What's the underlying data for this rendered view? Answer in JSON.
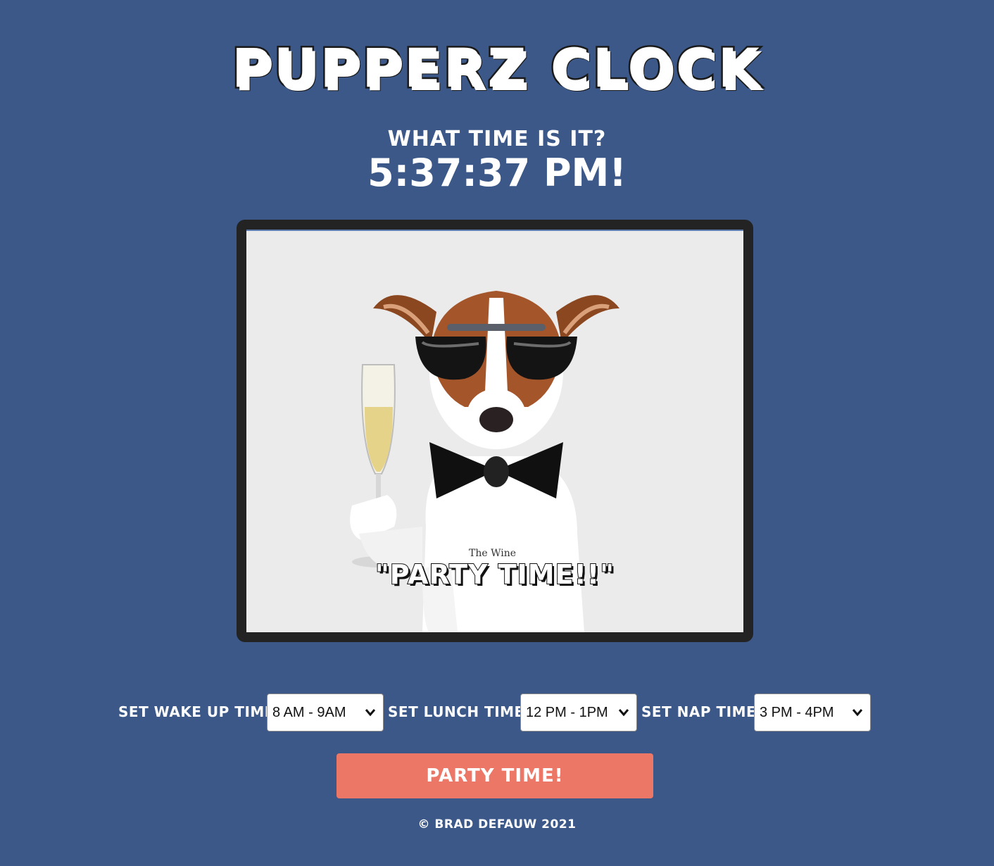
{
  "header": {
    "title": "PUPPERZ CLOCK",
    "question": "WHAT TIME IS IT?",
    "time": "5:37:37 PM!"
  },
  "image": {
    "caption": "\"PARTY TIME!!\"",
    "watermark": "The Wine"
  },
  "controls": {
    "wake": {
      "label": "SET WAKE UP TIME",
      "value": "8 AM - 9AM"
    },
    "lunch": {
      "label": "SET LUNCH TIME",
      "value": "12 PM - 1PM"
    },
    "nap": {
      "label": "SET NAP TIME",
      "value": "3 PM - 4PM"
    }
  },
  "party_button": {
    "label": "PARTY TIME!"
  },
  "footer": {
    "text": "© BRAD DEFAUW 2021"
  },
  "colors": {
    "background": "#3b5889",
    "button": "#ec7766",
    "frame": "#232323",
    "text": "#ffffff"
  }
}
